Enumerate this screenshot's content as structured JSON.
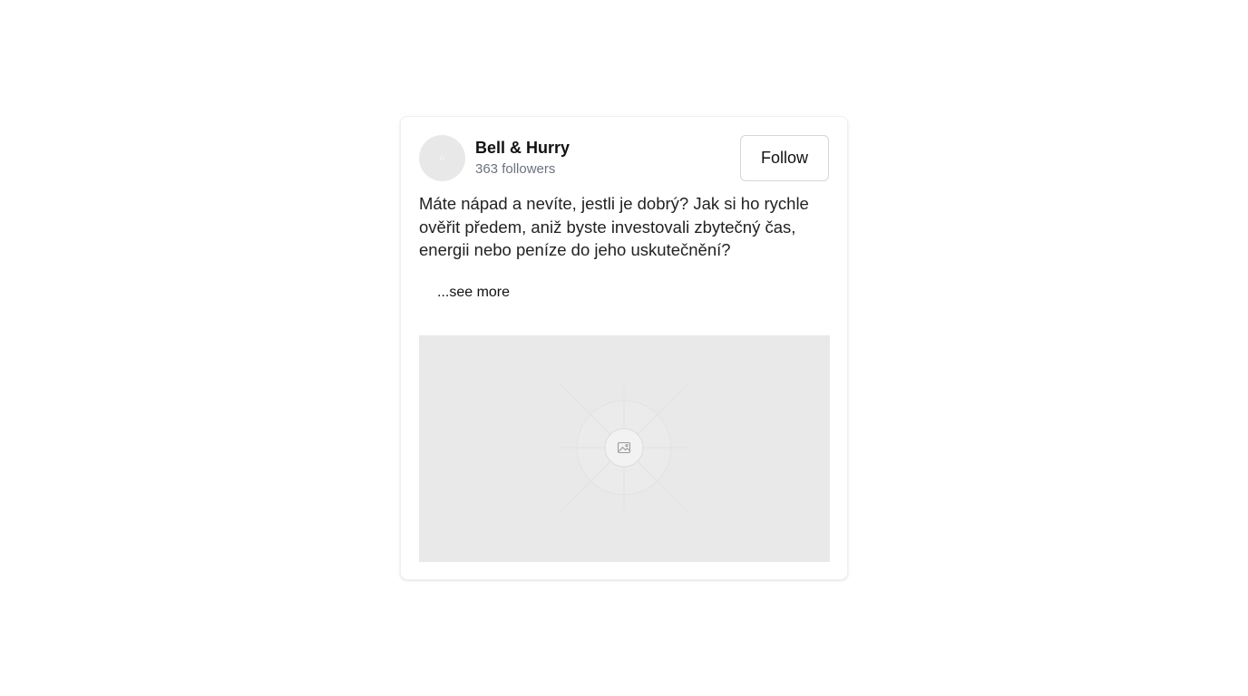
{
  "post": {
    "author": {
      "name": "Bell & Hurry",
      "followers": "363 followers",
      "avatar_icon": "avatar-placeholder-icon"
    },
    "follow_label": "Follow",
    "text": "Máte nápad a nevíte, jestli je dobrý? Jak si ho rychle ověřit předem, aniž byste investovali zbytečný čas, energii nebo peníze do jeho uskutečnění?",
    "see_more_label": "...see more",
    "media": {
      "icon": "image-placeholder-icon",
      "background": "#e9e9e9"
    }
  },
  "colors": {
    "page_background": "#ffffff",
    "card_background": "#ffffff",
    "text_primary": "#111111",
    "text_secondary": "#6b7280",
    "placeholder": "#e9e9e9"
  }
}
